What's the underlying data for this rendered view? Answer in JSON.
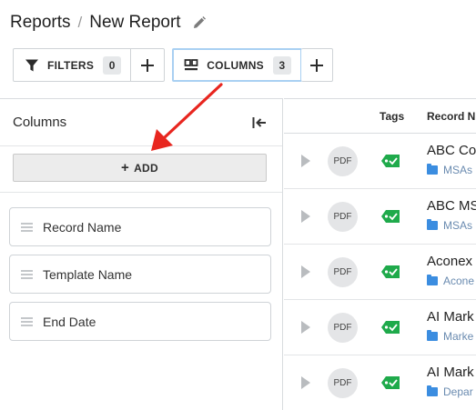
{
  "breadcrumb": {
    "root": "Reports",
    "separator": "/",
    "current": "New Report"
  },
  "toolbar": {
    "filters": {
      "label": "FILTERS",
      "count": "0"
    },
    "columns": {
      "label": "COLUMNS",
      "count": "3"
    }
  },
  "columns_panel": {
    "title": "Columns",
    "add_label": "ADD",
    "items": [
      {
        "label": "Record Name"
      },
      {
        "label": "Template Name"
      },
      {
        "label": "End Date"
      }
    ]
  },
  "table": {
    "headers": {
      "tags": "Tags",
      "record_name": "Record N"
    },
    "rows": [
      {
        "file_type": "PDF",
        "name": "ABC Co",
        "folder": "MSAs"
      },
      {
        "file_type": "PDF",
        "name": "ABC MS",
        "folder": "MSAs"
      },
      {
        "file_type": "PDF",
        "name": "Aconex",
        "folder": "Acone"
      },
      {
        "file_type": "PDF",
        "name": "AI Mark",
        "folder": "Marke"
      },
      {
        "file_type": "PDF",
        "name": "AI Mark",
        "folder": "Depar"
      }
    ]
  },
  "colors": {
    "tag_green": "#1faa4b",
    "folder_blue": "#3b8de0",
    "active_border": "#a9d0f2",
    "annotation_arrow": "#e8261f"
  },
  "icons": {
    "edit": "pencil-icon",
    "filter": "funnel-icon",
    "columns": "columns-icon",
    "plus": "plus-icon",
    "collapse": "collapse-left-icon",
    "drag": "drag-handle-icon",
    "expand": "play-triangle-icon",
    "tag": "tag-icon",
    "folder": "folder-icon"
  }
}
